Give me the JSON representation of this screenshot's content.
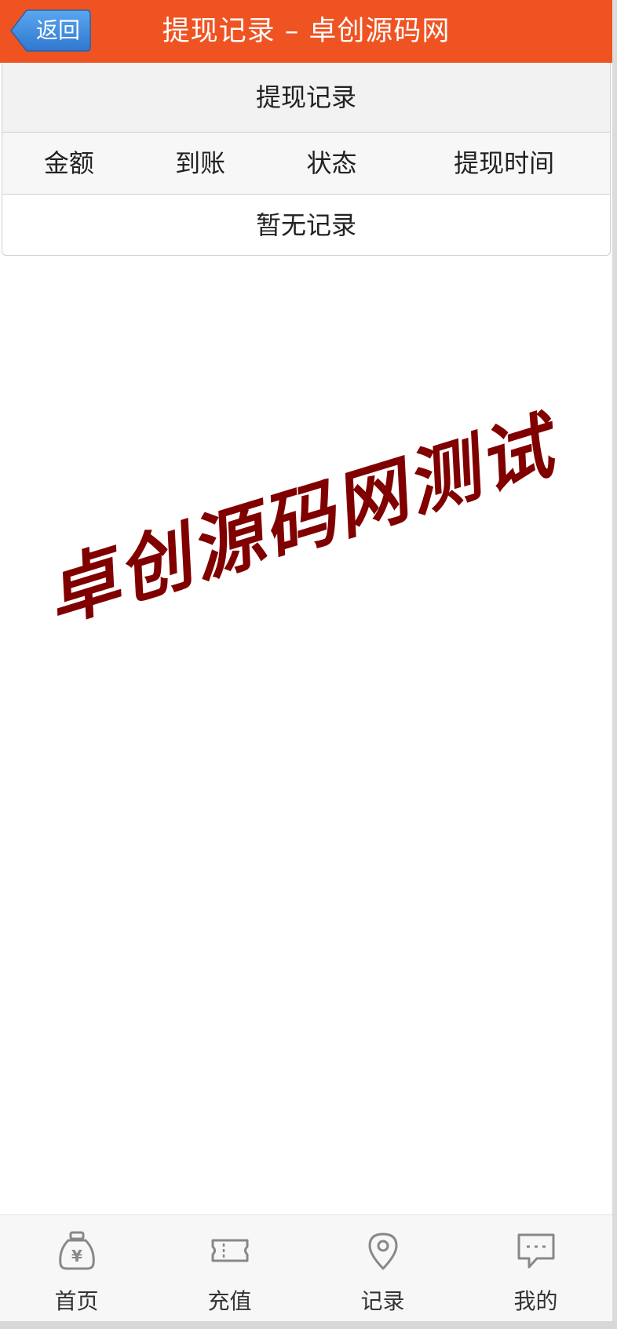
{
  "header": {
    "back_label": "返回",
    "title": "提现记录 – 卓创源码网",
    "bg_color": "#ef5322",
    "back_color": "#3a87d9"
  },
  "panel": {
    "title": "提现记录",
    "columns": [
      "金额",
      "到账",
      "状态",
      "提现时间"
    ],
    "empty_text": "暂无记录"
  },
  "watermark": {
    "text": "卓创源码网测试",
    "color": "#800000"
  },
  "bottom_nav": {
    "items": [
      {
        "label": "首页",
        "icon": "money-bag-icon"
      },
      {
        "label": "充值",
        "icon": "ticket-icon"
      },
      {
        "label": "记录",
        "icon": "location-pin-icon"
      },
      {
        "label": "我的",
        "icon": "chat-bubble-icon"
      }
    ]
  }
}
